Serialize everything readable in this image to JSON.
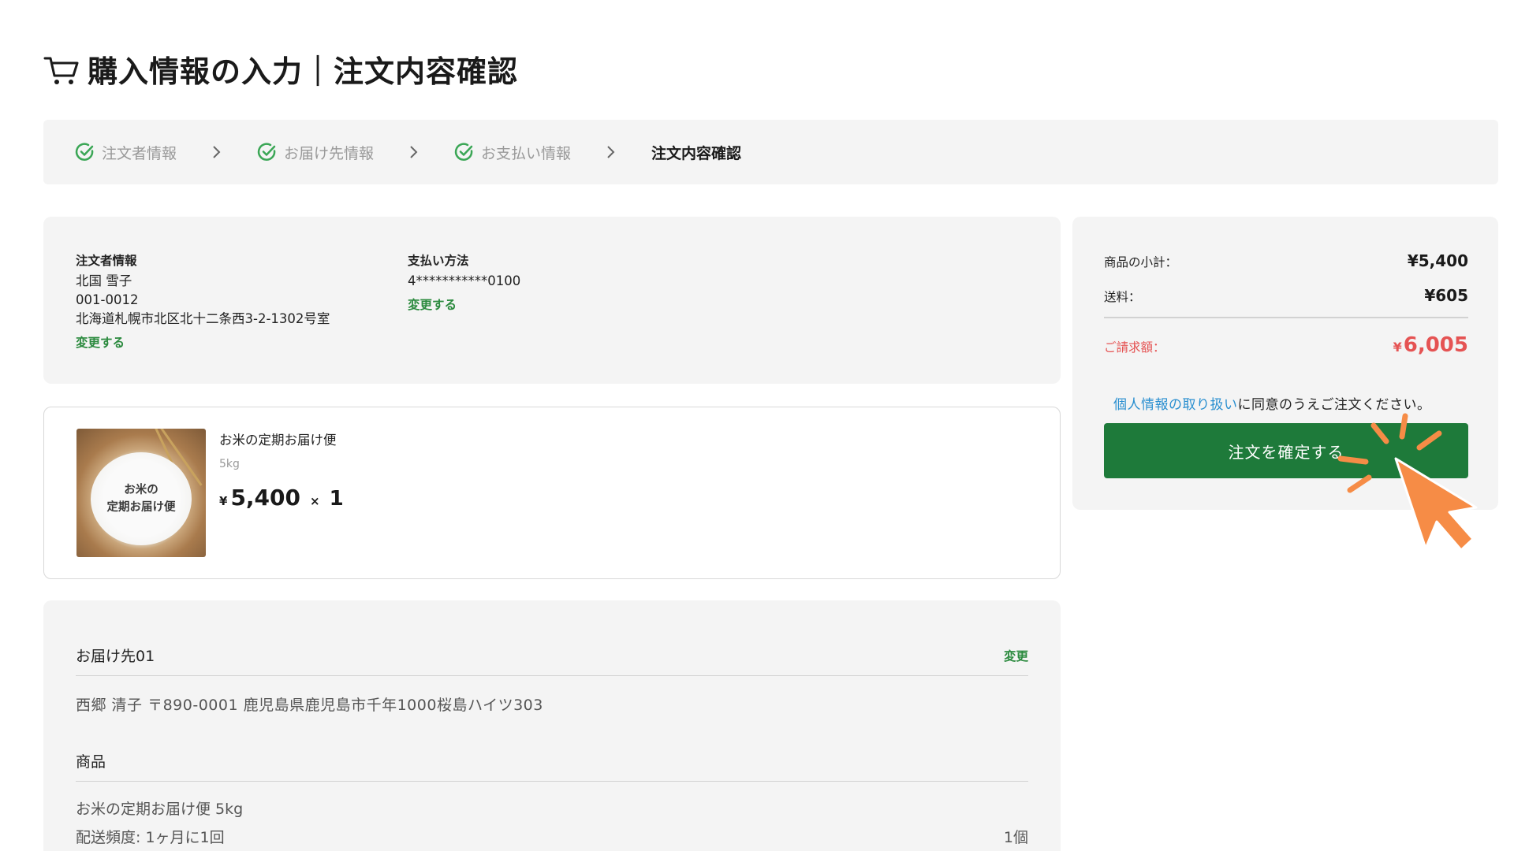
{
  "header": {
    "title": "購入情報の入力｜注文内容確認"
  },
  "steps": [
    {
      "label": "注文者情報",
      "status": "done"
    },
    {
      "label": "お届け先情報",
      "status": "done"
    },
    {
      "label": "お支払い情報",
      "status": "done"
    },
    {
      "label": "注文内容確認",
      "status": "current"
    }
  ],
  "orderer": {
    "label": "注文者情報",
    "name": "北国 雪子",
    "postal": "001-0012",
    "address": "北海道札幌市北区北十二条西3-2-1302号室",
    "change_label": "変更する"
  },
  "payment": {
    "label": "支払い方法",
    "card": "4***********0100",
    "change_label": "変更する"
  },
  "product": {
    "image_text_line1": "お米の",
    "image_text_line2": "定期お届け便",
    "name": "お米の定期お届け便",
    "weight": "5kg",
    "currency": "¥",
    "price": "5,400",
    "times": "×",
    "quantity": "1"
  },
  "delivery": {
    "title": "お届け先01",
    "change_label": "変更",
    "address": "西郷 清子  〒890-0001  鹿児島県鹿児島市千年1000桜島ハイツ303",
    "goods_label": "商品",
    "goods_name": "お米の定期お届け便 5kg",
    "frequency": "配送頻度: 1ヶ月に1回",
    "count": "1個"
  },
  "summary": {
    "subtotal_label": "商品の小計：",
    "subtotal_value": "¥5,400",
    "shipping_label": "送料：",
    "shipping_value": "¥605",
    "total_label": "ご請求額：",
    "total_currency": "¥",
    "total_value": "6,005",
    "consent_link": "個人情報の取り扱い",
    "consent_text": "に同意のうえご注文ください。",
    "confirm_label": "注文を確定する"
  },
  "colors": {
    "brand_green": "#1e7a3a",
    "link_green": "#2b8a3e",
    "check_green": "#3aa655",
    "total_red": "#e55353",
    "link_blue": "#2a8fd0",
    "pointer_orange": "#f68c46"
  }
}
